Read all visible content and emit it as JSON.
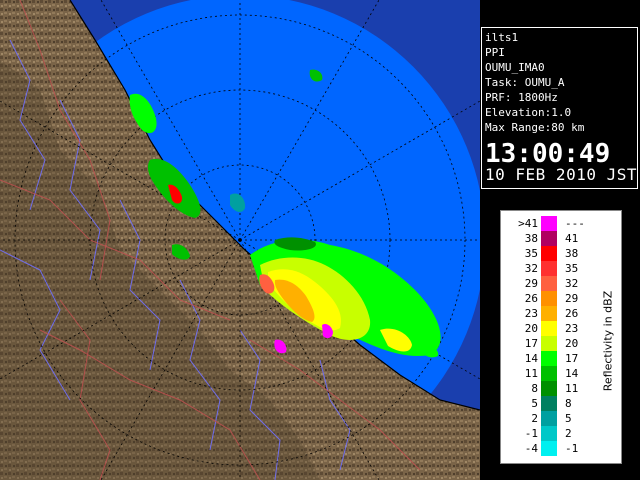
{
  "info": {
    "site": "ilts1",
    "scan_type": "PPI",
    "station": "OUMU_IMA0",
    "task": "Task: OUMU_A",
    "prf": "PRF: 1800Hz",
    "elevation": "Elevation:1.0",
    "max_range": "Max Range:80 km",
    "time": "13:00:49",
    "date": "10 FEB 2010 JST"
  },
  "legend": {
    "title": "Reflectivity in dBZ",
    "rows": [
      {
        "lo": ">41",
        "hi": "---",
        "color": "#ff00ff"
      },
      {
        "lo": "38",
        "hi": "41",
        "color": "#b00060"
      },
      {
        "lo": "35",
        "hi": "38",
        "color": "#ff0000"
      },
      {
        "lo": "32",
        "hi": "35",
        "color": "#ff3030"
      },
      {
        "lo": "29",
        "hi": "32",
        "color": "#ff6040"
      },
      {
        "lo": "26",
        "hi": "29",
        "color": "#ff9000"
      },
      {
        "lo": "23",
        "hi": "26",
        "color": "#ffb000"
      },
      {
        "lo": "20",
        "hi": "23",
        "color": "#ffff00"
      },
      {
        "lo": "17",
        "hi": "20",
        "color": "#c8ff00"
      },
      {
        "lo": "14",
        "hi": "17",
        "color": "#00ff00"
      },
      {
        "lo": "11",
        "hi": "14",
        "color": "#00c000"
      },
      {
        "lo": "8",
        "hi": "11",
        "color": "#009000"
      },
      {
        "lo": "5",
        "hi": "8",
        "color": "#008060"
      },
      {
        "lo": "2",
        "hi": "5",
        "color": "#00a0a0"
      },
      {
        "lo": "-1",
        "hi": "2",
        "color": "#00c8c8"
      },
      {
        "lo": "-4",
        "hi": "-1",
        "color": "#00f0f0"
      }
    ]
  },
  "colors": {
    "sea": "#0066ff",
    "outer_range": "#1a3fae",
    "land": "#7a6448",
    "land_dark": "#4e3e2c",
    "rivers": "#7070ff",
    "borders": "#c05050"
  }
}
